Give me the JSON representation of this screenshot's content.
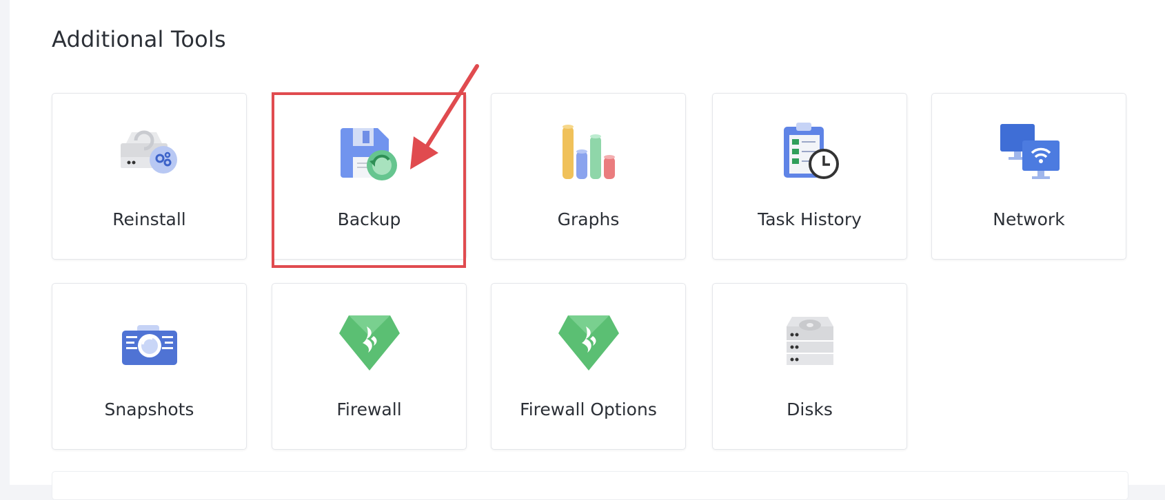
{
  "section": {
    "title": "Additional Tools"
  },
  "tools": [
    {
      "label": "Reinstall",
      "icon": "reinstall-icon"
    },
    {
      "label": "Backup",
      "icon": "backup-icon"
    },
    {
      "label": "Graphs",
      "icon": "graphs-icon"
    },
    {
      "label": "Task History",
      "icon": "task-history-icon"
    },
    {
      "label": "Network",
      "icon": "network-icon"
    },
    {
      "label": "Snapshots",
      "icon": "snapshots-icon"
    },
    {
      "label": "Firewall",
      "icon": "firewall-icon"
    },
    {
      "label": "Firewall Options",
      "icon": "firewall-options-icon"
    },
    {
      "label": "Disks",
      "icon": "disks-icon"
    }
  ],
  "annotation": {
    "highlighted_tool": "Backup",
    "color": "#e04b4f"
  }
}
